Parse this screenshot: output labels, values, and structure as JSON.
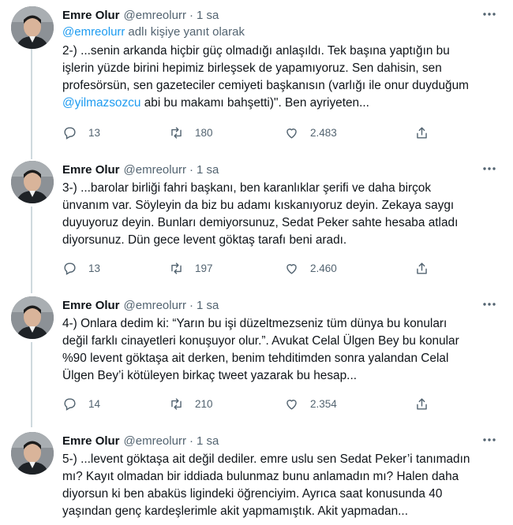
{
  "tweets": [
    {
      "name": "Emre Olur",
      "handle": "@emreolurr",
      "dot": "·",
      "time": "1 sa",
      "reply_mention": "@emreolurr",
      "reply_rest": "adlı kişiye yanıt olarak",
      "text_lines": [
        "2-) ...senin arkanda hiçbir güç olmadığı anlaşıldı. Tek başına yaptığın bu",
        "işlerin yüzde birini hepimiz birleşsek de yapamıyoruz. Sen dahisin, sen",
        "profesörsün, sen gazeteciler cemiyeti başkanısın (varlığı ile onur duyduğum"
      ],
      "text_last_mention": "@yilmazsozcu",
      "text_last_rest": " abi bu makamı bahşetti)\". Ben ayriyeten...",
      "replies": "13",
      "retweets": "180",
      "likes": "2.483"
    },
    {
      "name": "Emre Olur",
      "handle": "@emreolurr",
      "dot": "·",
      "time": "1 sa",
      "text_lines": [
        "3-) ...barolar birliği fahri başkanı, ben karanlıklar şerifi ve daha birçok",
        "ünvanım var. Söyleyin da biz bu adamı kıskanıyoruz deyin. Zekaya saygı",
        "duyuyoruz deyin. Bunları demiyorsunuz, Sedat Peker sahte hesaba atladı",
        "diyorsunuz. Dün gece levent göktaş tarafı beni aradı."
      ],
      "replies": "13",
      "retweets": "197",
      "likes": "2.460"
    },
    {
      "name": "Emre Olur",
      "handle": "@emreolurr",
      "dot": "·",
      "time": "1 sa",
      "text_lines": [
        "4-) Onlara dedim ki: “Yarın bu işi düzeltmezseniz tüm dünya bu konuları",
        "değil farklı cinayetleri konuşuyor olur.”. Avukat Celal Ülgen Bey bu konular",
        "%90 levent göktaşa ait derken, benim tehditimden sonra yalandan Celal",
        "Ülgen Bey’i kötüleyen birkaç tweet yazarak bu hesap..."
      ],
      "replies": "14",
      "retweets": "210",
      "likes": "2.354"
    },
    {
      "name": "Emre Olur",
      "handle": "@emreolurr",
      "dot": "·",
      "time": "1 sa",
      "text_lines": [
        "5-) ...levent göktaşa ait değil dediler. emre uslu sen Sedat Peker’i tanımadın",
        "mı? Kayıt olmadan bir iddiada bulunmaz bunu anlamadın mı? Halen daha",
        "diyorsun ki ben abaküs ligindeki öğrenciyim. Ayrıca saat konusunda 40",
        "yaşından genç kardeşlerimle akit yapmamıştık. Akit yapmadan..."
      ]
    }
  ],
  "icons": {
    "avatar": "profile-photo",
    "more": "more-horizontal-icon",
    "reply": "reply-icon",
    "retweet": "retweet-icon",
    "like": "heart-icon",
    "share": "share-icon"
  },
  "colors": {
    "link": "#1d9bf0",
    "muted": "#536471",
    "thread_line": "#cfd9de"
  }
}
